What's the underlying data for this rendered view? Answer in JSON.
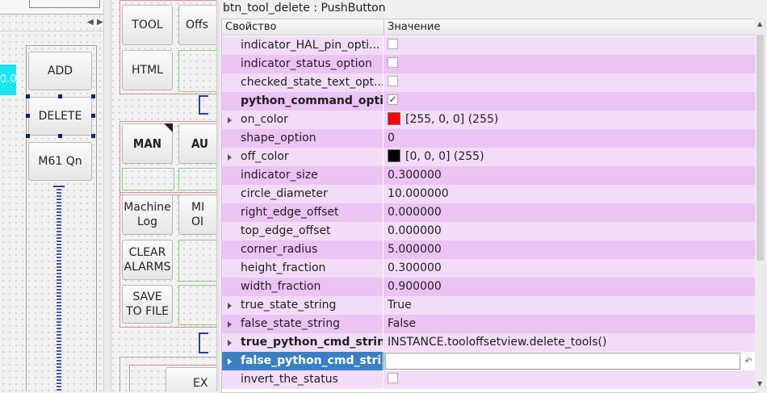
{
  "canvas": {
    "top_left_labels": [
      "TOOL",
      "Offs"
    ],
    "html_button": "HTML",
    "add_button": "ADD",
    "delete_button": "DELETE",
    "m61_button": "M61 Qn",
    "man_button": "MAN",
    "au_button": "AU",
    "machine_log_button": [
      "Machine",
      "Log"
    ],
    "mi_button": [
      "MI",
      "OI"
    ],
    "clear_alarms_button": [
      "CLEAR",
      "ALARMS"
    ],
    "save_to_file_button": [
      "SAVE",
      "TO FILE"
    ],
    "ex_button": "EX",
    "cyan_value": "0.0"
  },
  "property_editor": {
    "title": "btn_tool_delete : PushButton",
    "columns": {
      "property": "Свойство",
      "value": "Значение"
    },
    "rows": [
      {
        "name": "indicator_HAL_pin_opti...",
        "value": "",
        "kind": "checkbox",
        "checked": false,
        "bold": false,
        "expandable": false,
        "bg": "#f3dcf7"
      },
      {
        "name": "indicator_status_option",
        "value": "",
        "kind": "checkbox",
        "checked": false,
        "bold": false,
        "expandable": false,
        "bg": "#ecc3f5"
      },
      {
        "name": "checked_state_text_opt...",
        "value": "",
        "kind": "checkbox",
        "checked": false,
        "bold": false,
        "expandable": false,
        "bg": "#f3dcf7"
      },
      {
        "name": "python_command_opti...",
        "value": "✓",
        "kind": "checkbox",
        "checked": true,
        "bold": true,
        "expandable": false,
        "bg": "#ecc3f5"
      },
      {
        "name": "on_color",
        "value": "[255, 0, 0] (255)",
        "kind": "color",
        "swatch": "#ff0000",
        "bold": false,
        "expandable": true,
        "bg": "#f3dcf7"
      },
      {
        "name": "shape_option",
        "value": "0",
        "kind": "text",
        "bold": false,
        "expandable": false,
        "bg": "#ecc3f5"
      },
      {
        "name": "off_color",
        "value": "[0, 0, 0] (255)",
        "kind": "color",
        "swatch": "#000000",
        "bold": false,
        "expandable": true,
        "bg": "#f3dcf7"
      },
      {
        "name": "indicator_size",
        "value": "0.300000",
        "kind": "text",
        "bold": false,
        "expandable": false,
        "bg": "#ecc3f5"
      },
      {
        "name": "circle_diameter",
        "value": "10.000000",
        "kind": "text",
        "bold": false,
        "expandable": false,
        "bg": "#f3dcf7"
      },
      {
        "name": "right_edge_offset",
        "value": "0.000000",
        "kind": "text",
        "bold": false,
        "expandable": false,
        "bg": "#ecc3f5"
      },
      {
        "name": "top_edge_offset",
        "value": "0.000000",
        "kind": "text",
        "bold": false,
        "expandable": false,
        "bg": "#f3dcf7"
      },
      {
        "name": "corner_radius",
        "value": "5.000000",
        "kind": "text",
        "bold": false,
        "expandable": false,
        "bg": "#ecc3f5"
      },
      {
        "name": "height_fraction",
        "value": "0.300000",
        "kind": "text",
        "bold": false,
        "expandable": false,
        "bg": "#f3dcf7"
      },
      {
        "name": "width_fraction",
        "value": "0.900000",
        "kind": "text",
        "bold": false,
        "expandable": false,
        "bg": "#ecc3f5"
      },
      {
        "name": "true_state_string",
        "value": "True",
        "kind": "text",
        "bold": false,
        "expandable": true,
        "bg": "#f3dcf7"
      },
      {
        "name": "false_state_string",
        "value": "False",
        "kind": "text",
        "bold": false,
        "expandable": true,
        "bg": "#ecc3f5"
      },
      {
        "name": "true_python_cmd_string",
        "value": "INSTANCE.tooloffsetview.delete_tools()",
        "kind": "text",
        "bold": true,
        "expandable": true,
        "bg": "#f3dcf7"
      },
      {
        "name": "false_python_cmd_stri...",
        "value": "",
        "kind": "editing",
        "bold": true,
        "expandable": true,
        "bg": "#3a7fc4",
        "selected": true
      },
      {
        "name": "invert_the_status",
        "value": "",
        "kind": "checkbox",
        "checked": false,
        "bold": false,
        "expandable": false,
        "bg": "#f3dcf7"
      }
    ]
  }
}
